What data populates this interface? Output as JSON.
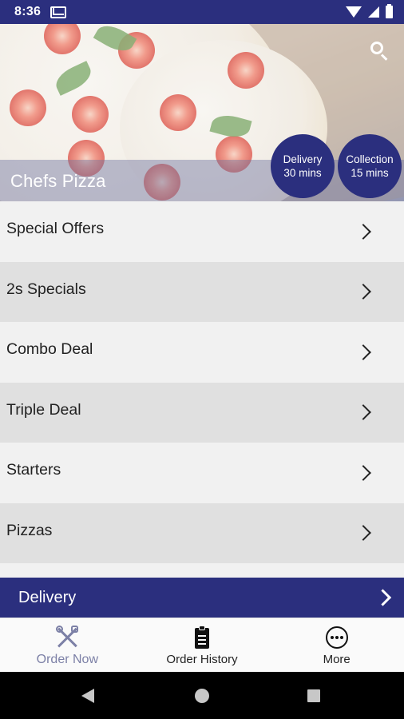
{
  "status_bar": {
    "time": "8:36",
    "icons": [
      "gmail-icon",
      "wifi-icon",
      "signal-icon",
      "battery-icon"
    ]
  },
  "hero": {
    "restaurant_name": "Chefs Pizza",
    "delivery_badge": {
      "line1": "Delivery",
      "line2": "30 mins"
    },
    "collection_badge": {
      "line1": "Collection",
      "line2": "15 mins"
    }
  },
  "menu": {
    "items": [
      {
        "label": "Special Offers"
      },
      {
        "label": "2s Specials"
      },
      {
        "label": "Combo Deal"
      },
      {
        "label": "Triple Deal"
      },
      {
        "label": "Starters"
      },
      {
        "label": "Pizzas"
      }
    ]
  },
  "delivery_bar": {
    "label": "Delivery"
  },
  "bottom_nav": {
    "items": [
      {
        "label": "Order Now",
        "icon": "fork-knife-icon",
        "active": true
      },
      {
        "label": "Order History",
        "icon": "clipboard-icon",
        "active": false
      },
      {
        "label": "More",
        "icon": "more-icon",
        "active": false
      }
    ]
  },
  "colors": {
    "primary": "#2b2f7e",
    "row_light": "#f1f1f1",
    "row_dark": "#e0e0e0",
    "active_nav": "#7c80a6"
  }
}
